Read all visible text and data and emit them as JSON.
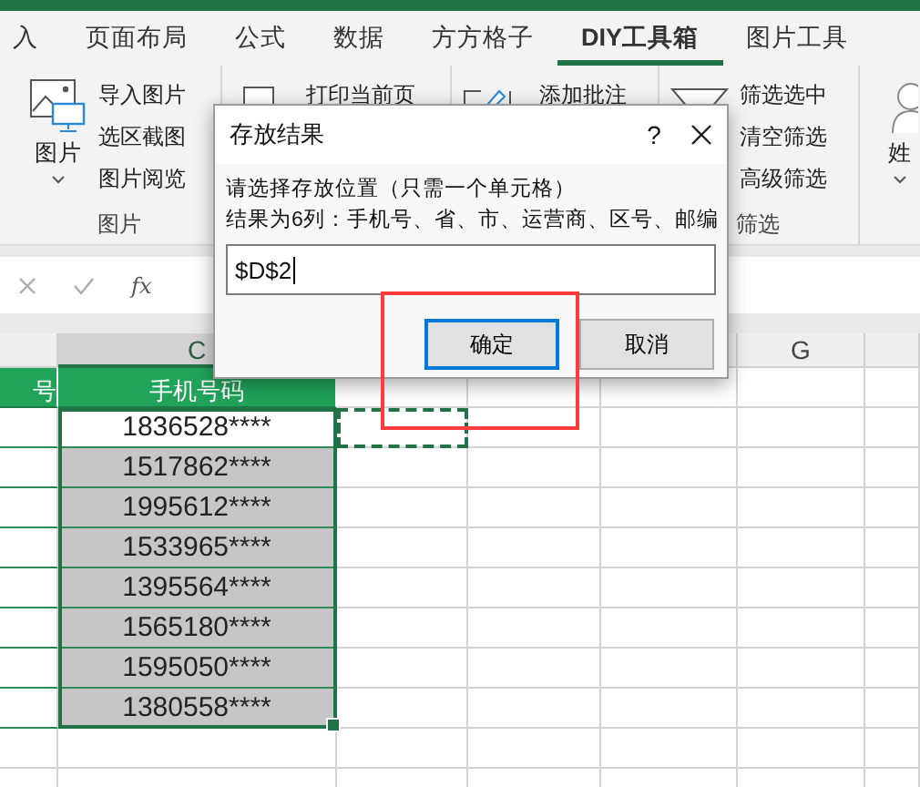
{
  "tabs": [
    {
      "label": "入",
      "selected": false
    },
    {
      "label": "页面布局",
      "selected": false
    },
    {
      "label": "公式",
      "selected": false
    },
    {
      "label": "数据",
      "selected": false
    },
    {
      "label": "方方格子",
      "selected": false
    },
    {
      "label": "DIY工具箱",
      "selected": true
    },
    {
      "label": "图片工具",
      "selected": false
    }
  ],
  "ribbon_groups": [
    {
      "kind": "picture",
      "big_button": "图片",
      "items": [
        "导入图片",
        "选区截图",
        "图片阅览"
      ],
      "label": "图片"
    },
    {
      "kind": "print",
      "items": [
        "打印当前页"
      ]
    },
    {
      "kind": "comment",
      "items": [
        "添加批注"
      ]
    },
    {
      "kind": "filter",
      "items": [
        "筛选选中",
        "清空筛选",
        "高级筛选"
      ],
      "label": "筛选"
    },
    {
      "kind": "account",
      "big_button": "姓"
    }
  ],
  "formula_bar": {
    "function_label": "fx"
  },
  "sheet": {
    "column_headers": [
      {
        "label": "C",
        "selected": true
      },
      {
        "label": "G",
        "selected": false
      }
    ],
    "header_cells": [
      "号",
      "手机号码"
    ],
    "phone_cells": [
      {
        "value": "1836528****",
        "active": true
      },
      {
        "value": "1517862****",
        "active": false
      },
      {
        "value": "1995612****",
        "active": false
      },
      {
        "value": "1533965****",
        "active": false
      },
      {
        "value": "1395564****",
        "active": false
      },
      {
        "value": "1565180****",
        "active": false
      },
      {
        "value": "1595050****",
        "active": false
      },
      {
        "value": "1380558****",
        "active": false
      }
    ],
    "copy_marquee_on_first_row": true
  },
  "dialog": {
    "title": "存放结果",
    "help": "?",
    "prompt": "请选择存放位置（只需一个单元格）",
    "note": "结果为6列：手机号、省、市、运营商、区号、邮编",
    "value": "$D$2",
    "buttons": [
      {
        "label": "确定",
        "default": true
      },
      {
        "label": "取消",
        "default": false
      }
    ]
  },
  "highlight_box": {
    "shown": true
  }
}
